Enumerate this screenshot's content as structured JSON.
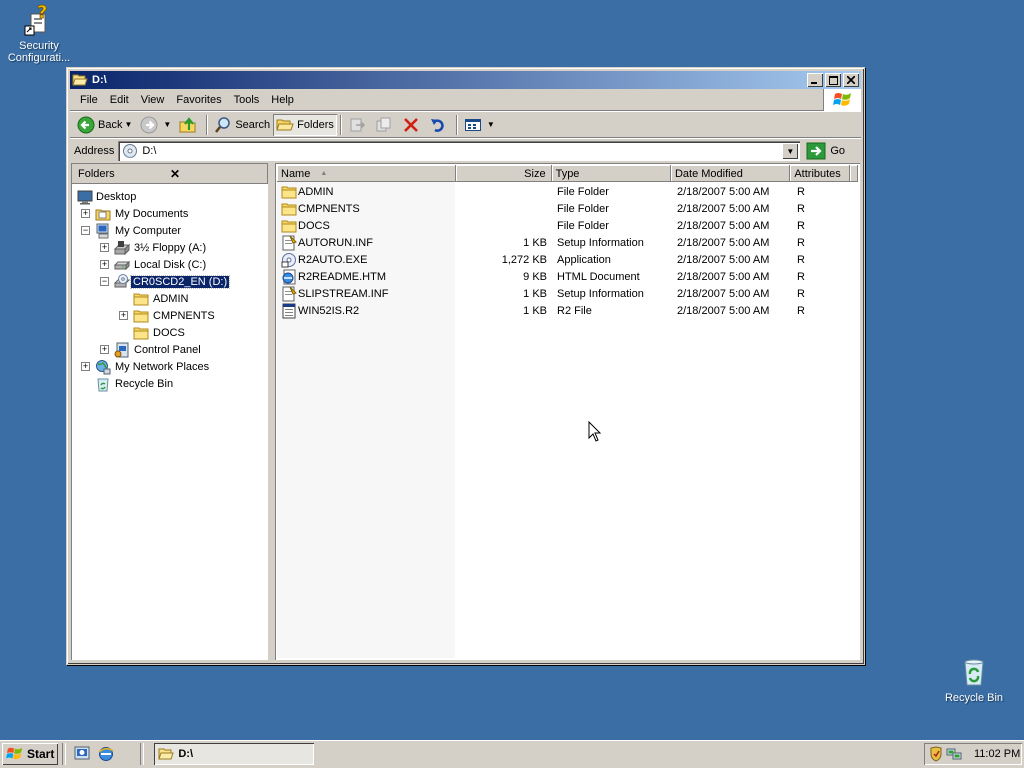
{
  "desktop": {
    "icons": [
      {
        "label_line1": "Security",
        "label_line2": "Configurati..."
      },
      {
        "label_line1": "Recycle Bin",
        "label_line2": ""
      }
    ]
  },
  "window": {
    "title": "D:\\",
    "menu": [
      "File",
      "Edit",
      "View",
      "Favorites",
      "Tools",
      "Help"
    ],
    "toolbar": {
      "back": "Back",
      "search": "Search",
      "folders": "Folders"
    },
    "address": {
      "label": "Address",
      "value": "D:\\",
      "go": "Go"
    },
    "folders_pane": {
      "title": "Folders",
      "tree": [
        {
          "label": "Desktop"
        },
        {
          "label": "My Documents"
        },
        {
          "label": "My Computer"
        },
        {
          "label": "3½ Floppy (A:)"
        },
        {
          "label": "Local Disk (C:)"
        },
        {
          "label": "CR0SCD2_EN (D:)"
        },
        {
          "label": "ADMIN"
        },
        {
          "label": "CMPNENTS"
        },
        {
          "label": "DOCS"
        },
        {
          "label": "Control Panel"
        },
        {
          "label": "My Network Places"
        },
        {
          "label": "Recycle Bin"
        }
      ]
    },
    "columns": [
      "Name",
      "Size",
      "Type",
      "Date Modified",
      "Attributes"
    ],
    "files": [
      {
        "name": "ADMIN",
        "size": "",
        "type": "File Folder",
        "date": "2/18/2007 5:00 AM",
        "attr": "R",
        "icon": "folder-icon"
      },
      {
        "name": "CMPNENTS",
        "size": "",
        "type": "File Folder",
        "date": "2/18/2007 5:00 AM",
        "attr": "R",
        "icon": "folder-icon"
      },
      {
        "name": "DOCS",
        "size": "",
        "type": "File Folder",
        "date": "2/18/2007 5:00 AM",
        "attr": "R",
        "icon": "folder-icon"
      },
      {
        "name": "AUTORUN.INF",
        "size": "1 KB",
        "type": "Setup Information",
        "date": "2/18/2007 5:00 AM",
        "attr": "R",
        "icon": "setup-info-icon"
      },
      {
        "name": "R2AUTO.EXE",
        "size": "1,272 KB",
        "type": "Application",
        "date": "2/18/2007 5:00 AM",
        "attr": "R",
        "icon": "application-icon"
      },
      {
        "name": "R2README.HTM",
        "size": "9 KB",
        "type": "HTML Document",
        "date": "2/18/2007 5:00 AM",
        "attr": "R",
        "icon": "html-document-icon"
      },
      {
        "name": "SLIPSTREAM.INF",
        "size": "1 KB",
        "type": "Setup Information",
        "date": "2/18/2007 5:00 AM",
        "attr": "R",
        "icon": "setup-info-icon"
      },
      {
        "name": "WIN52IS.R2",
        "size": "1 KB",
        "type": "R2 File",
        "date": "2/18/2007 5:00 AM",
        "attr": "R",
        "icon": "generic-file-icon"
      }
    ]
  },
  "taskbar": {
    "start": "Start",
    "task": "D:\\",
    "clock": "11:02 PM"
  }
}
